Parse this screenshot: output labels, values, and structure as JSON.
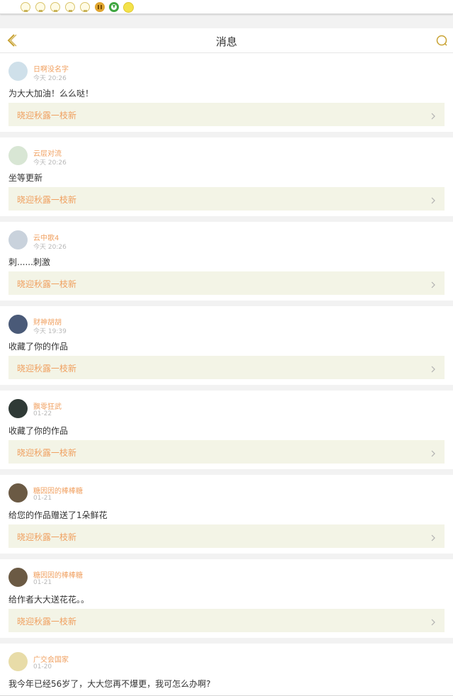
{
  "status_bar": {
    "icons": [
      "bulb-icon",
      "bulb-icon",
      "bulb-icon",
      "bulb-icon",
      "bulb-icon",
      "pause-icon",
      "download-icon",
      "sun-icon"
    ]
  },
  "nav": {
    "title": "消息",
    "back_icon": "back-chevron-icon",
    "search_icon": "search-icon",
    "accent_color": "#c8a232"
  },
  "colors": {
    "username": "#f0a060",
    "work_title": "#f0a060",
    "work_bg": "#f3f4e6",
    "time": "#b8b8b8"
  },
  "messages": [
    {
      "user": "日啊没名字",
      "time": "今天 20:26",
      "text": "为大大加油！么么哒！",
      "work": "晓迎秋露一枝新"
    },
    {
      "user": "云层对流",
      "time": "今天 20:26",
      "text": "坐等更新",
      "work": "晓迎秋露一枝新"
    },
    {
      "user": "云中歌4",
      "time": "今天 20:26",
      "text": "刺......刺激",
      "work": "晓迎秋露一枝新"
    },
    {
      "user": "财神胡胡",
      "time": "今天 19:39",
      "text": "收藏了你的作品",
      "work": "晓迎秋露一枝新"
    },
    {
      "user": "飘零狂武",
      "time": "01-22",
      "text": "收藏了你的作品",
      "work": "晓迎秋露一枝新"
    },
    {
      "user": "糖因因的棒棒糖",
      "time": "01-21",
      "text": "给您的作品赠送了1朵鲜花",
      "work": "晓迎秋露一枝新"
    },
    {
      "user": "糖因因的棒棒糖",
      "time": "01-21",
      "text": "给作者大大送花花。。",
      "work": "晓迎秋露一枝新"
    },
    {
      "user": "广交会国家",
      "time": "01-20",
      "text": "我今年已经56岁了，大大您再不爆更，我可怎么办啊?",
      "work": ""
    }
  ]
}
